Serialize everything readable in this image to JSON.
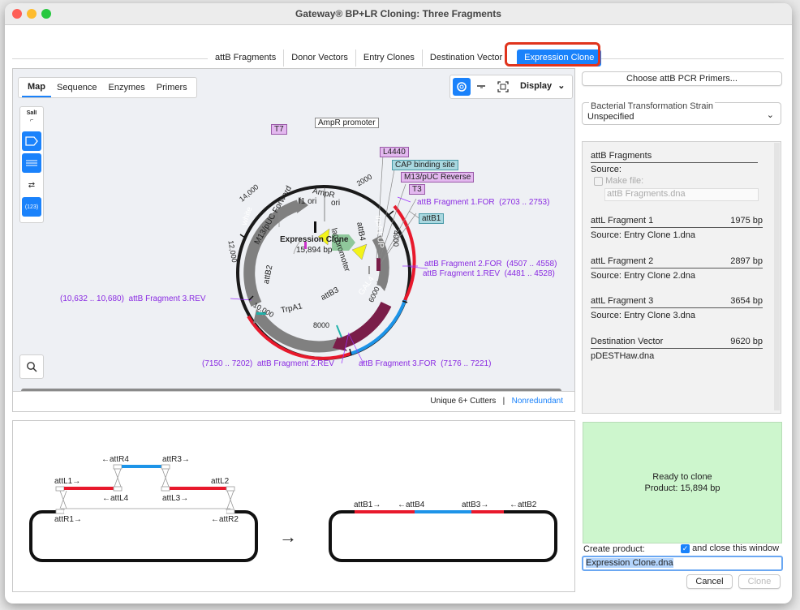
{
  "window": {
    "title": "Gateway® BP+LR Cloning: Three Fragments"
  },
  "tabs": [
    {
      "label": "attB Fragments"
    },
    {
      "label": "Donor Vectors"
    },
    {
      "label": "Entry Clones"
    },
    {
      "label": "Destination Vector"
    },
    {
      "label": "Expression Clone",
      "active": true
    }
  ],
  "map_tabs": [
    "Map",
    "Sequence",
    "Enzymes",
    "Primers"
  ],
  "view": {
    "display_label": "Display",
    "search_icon": "magnifier-icon"
  },
  "tools": {
    "cutter_label": "SalI",
    "count_label": "(123)"
  },
  "plasmid": {
    "name": "Expression Clone",
    "size": "15,894 bp",
    "ticks": [
      "2000",
      "4000",
      "6000",
      "8000",
      "10,000",
      "12,000",
      "14,000"
    ],
    "features": [
      "AmpR promoter",
      "T7",
      "L4440",
      "CAP binding site",
      "M13/pUC Reverse",
      "T3",
      "attB1",
      "f1 ori",
      "AmpR",
      "ori",
      "lac promoter",
      "attB4",
      "trpA1 UP",
      "GAL4",
      "attB3",
      "TrpA1",
      "attB2",
      "M13/pUC Forward",
      "white"
    ],
    "primers": [
      {
        "label": "attB Fragment 1.FOR",
        "range": "(2703 .. 2753)"
      },
      {
        "label": "attB Fragment 2.FOR",
        "range": "(4507 .. 4558)"
      },
      {
        "label": "attB Fragment 1.REV",
        "range": "(4481 .. 4528)"
      },
      {
        "label": "attB Fragment 3.REV",
        "range": "(10,632 .. 10,680)"
      },
      {
        "label": "attB Fragment 2.REV",
        "range": "(7150 .. 7202)"
      },
      {
        "label": "attB Fragment 3.FOR",
        "range": "(7176 .. 7221)"
      }
    ]
  },
  "status": {
    "cutters": "Unique 6+ Cutters",
    "sep": "|",
    "link": "Nonredundant"
  },
  "right": {
    "primers_button": "Choose attB PCR Primers...",
    "strain_label": "Bacterial Transformation Strain",
    "strain_value": "Unspecified"
  },
  "info": {
    "attb_title": "attB Fragments",
    "source_label": "Source:",
    "make_file_label": "Make file:",
    "make_file_value": "attB Fragments.dna",
    "fragments": [
      {
        "name": "attL Fragment 1",
        "bp": "1975 bp",
        "source": "Source:  Entry Clone 1.dna"
      },
      {
        "name": "attL Fragment 2",
        "bp": "2897 bp",
        "source": "Source:  Entry Clone 2.dna"
      },
      {
        "name": "attL Fragment 3",
        "bp": "3654 bp",
        "source": "Source:  Entry Clone 3.dna"
      },
      {
        "name": "Destination Vector",
        "bp": "9620 bp",
        "source": "pDESTHaw.dna"
      }
    ]
  },
  "diagram": {
    "left_labels": [
      "←attR4",
      "attR3→",
      "attL1→",
      "attL2",
      "←attL4",
      "attL3→",
      "attR1→",
      "←attR2"
    ],
    "right_labels": [
      "attB1→",
      "←attB4",
      "attB3→",
      "←attB2"
    ],
    "arrow": "→"
  },
  "ready": {
    "line1": "Ready to clone",
    "line2": "Product:  15,894 bp"
  },
  "product": {
    "create_label": "Create product:",
    "close_label": "and close this window",
    "filename": "Expression Clone.dna",
    "cancel": "Cancel",
    "clone": "Clone"
  },
  "colors": {
    "accent": "#1a82fb",
    "red": "#e8192c",
    "blue": "#1d94e8",
    "ready_bg": "#cdf6cd"
  }
}
